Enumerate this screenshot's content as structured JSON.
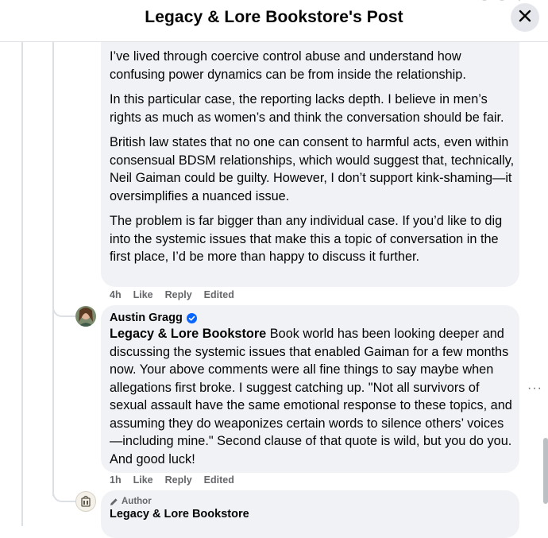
{
  "header": {
    "title": "Legacy & Lore Bookstore's Post"
  },
  "comment_1": {
    "paragraphs": [
      "I’ve lived through coercive control abuse and understand how confusing power dynamics can be from inside the relationship.",
      "In this particular case, the reporting lacks depth. I believe in men’s rights as much as women’s and think the conversation should be fair.",
      "British law states that no one can consent to harmful acts, even within consensual BDSM relationships, which would suggest that, technically, Neil Gaiman could be guilty. However, I don’t support kink-shaming—it oversimplifies a nuanced issue.",
      "The problem is far bigger than any individual case. If you’d like to dig into the systemic issues that make this a topic of conversation in the first place, I’d be more than happy to discuss it further."
    ],
    "time": "4h",
    "like": "Like",
    "reply": "Reply",
    "edited": "Edited"
  },
  "comment_2": {
    "author": "Austin Gragg",
    "verified_icon": "verified-badge-icon",
    "mention": "Legacy & Lore Bookstore",
    "text": " Book world has been looking deeper and discussing the systemic issues that enabled Gaiman for a few months now. Your above comments were all fine things to say maybe when allegations first broke. I suggest catching up. \"Not all survivors of sexual assault have the same emotional response to these topics, and assuming they do weaponizes certain words to silence others’ voices—including mine.\" Second clause of that quote is wild, but you do you. And good luck!",
    "time": "1h",
    "like": "Like",
    "reply": "Reply",
    "edited": "Edited",
    "more": "···"
  },
  "comment_3": {
    "badge": "Author",
    "author": "Legacy & Lore Bookstore"
  },
  "colors": {
    "bubble": "#f0f2f5",
    "verified": "#0866ff",
    "meta": "#65676b"
  }
}
